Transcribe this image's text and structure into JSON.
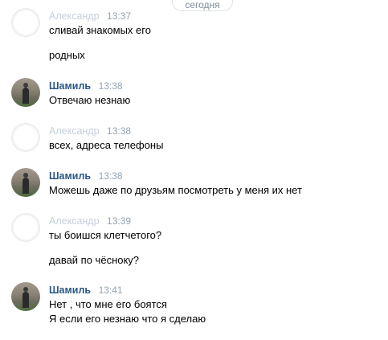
{
  "date_divider": "сегодня",
  "messages": [
    {
      "author": "Александр",
      "time": "13:37",
      "lines": [
        "сливай знакомых его",
        "родных"
      ]
    },
    {
      "author": "Шамиль",
      "time": "13:38",
      "lines": [
        "Отвечаю незнаю"
      ]
    },
    {
      "author": "Александр",
      "time": "13:38",
      "lines": [
        "всех, адреса телефоны"
      ]
    },
    {
      "author": "Шамиль",
      "time": "13:38",
      "lines": [
        "Можешь даже по друзьям посмотреть у меня их нет"
      ]
    },
    {
      "author": "Александр",
      "time": "13:39",
      "lines": [
        "ты боишся клетчетого?",
        "давай по чёсноку?"
      ]
    },
    {
      "author": "Шамиль",
      "time": "13:41",
      "lines": [
        "Нет , что мне его боятся",
        "Я если его незнаю что я сделаю"
      ]
    }
  ]
}
